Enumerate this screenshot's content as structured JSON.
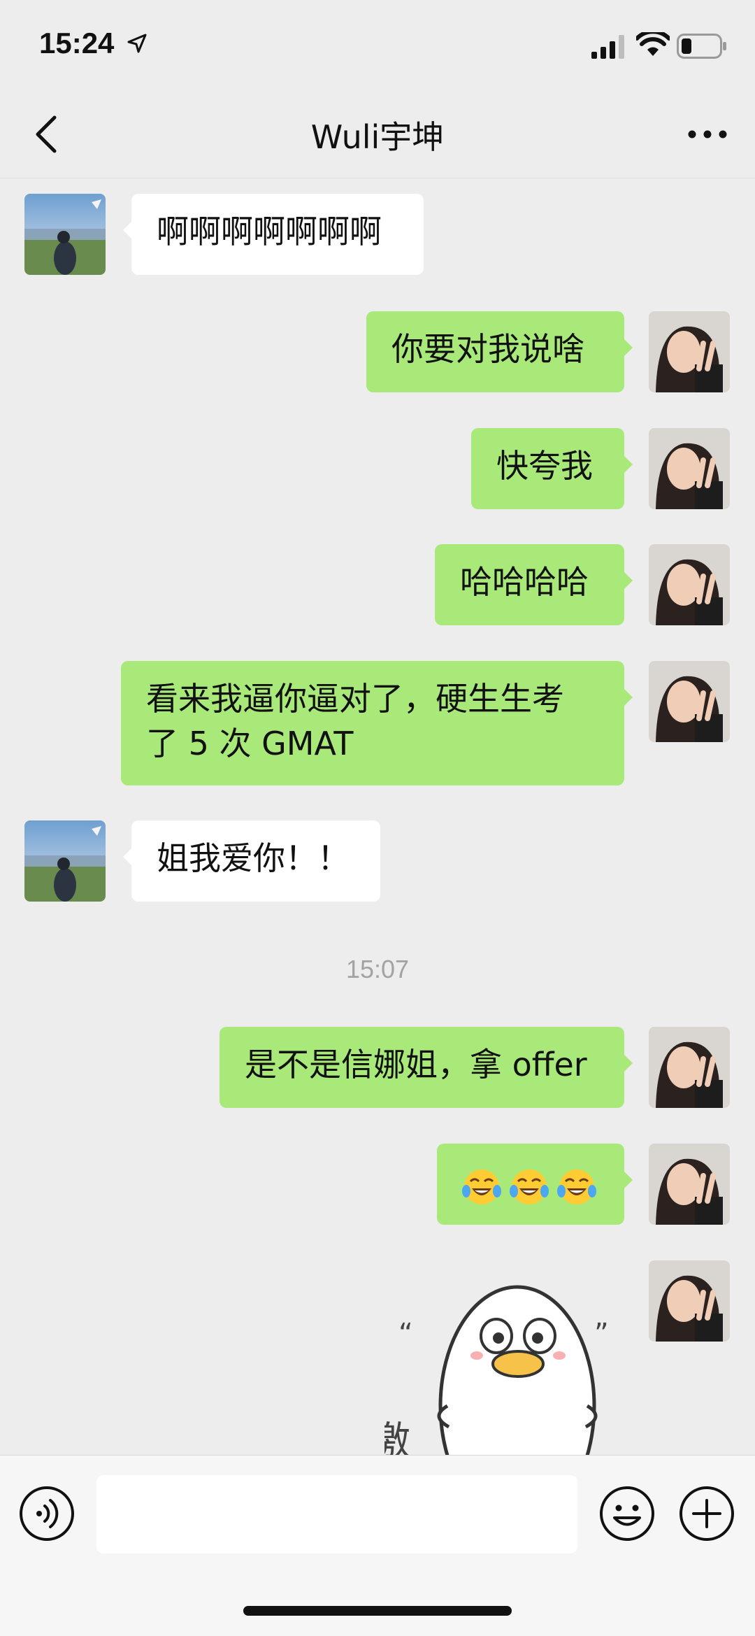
{
  "status_bar": {
    "time": "15:24"
  },
  "nav": {
    "title": "Wuli宇坤"
  },
  "messages": [
    {
      "side": "left",
      "text": "啊啊啊啊啊啊啊"
    },
    {
      "side": "right",
      "text": "你要对我说啥"
    },
    {
      "side": "right",
      "text": "快夸我"
    },
    {
      "side": "right",
      "text": "哈哈哈哈"
    },
    {
      "side": "right",
      "line1": "看来我逼你逼对了，硬生生考",
      "line2": "了 5 次 GMAT"
    },
    {
      "side": "left",
      "text": "姐我爱你！！"
    },
    {
      "side": "right",
      "text": "是不是信娜姐，拿 offer"
    },
    {
      "side": "right",
      "emojis": [
        "face-with-tears-of-joy",
        "face-with-tears-of-joy",
        "face-with-tears-of-joy"
      ]
    },
    {
      "side": "right",
      "sticker": "duck-sticker"
    }
  ],
  "timestamp": "15:07",
  "sticker": {
    "text": "激动",
    "quote_open": "“",
    "quote_close": "”"
  },
  "input": {
    "placeholder": ""
  },
  "colors": {
    "background": "#ededed",
    "my_bubble": "#a9e97a",
    "their_bubble": "#ffffff",
    "timestamp": "#a3a3a3"
  }
}
